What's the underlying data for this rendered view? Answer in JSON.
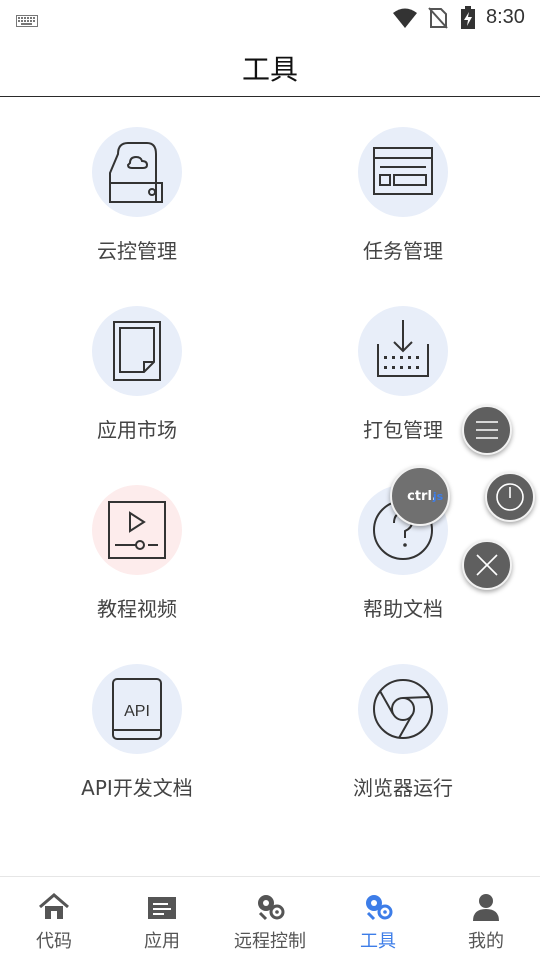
{
  "status_bar": {
    "time": "8:30",
    "icons": [
      "keyboard-icon",
      "wifi-icon",
      "no-sim-icon",
      "battery-charging-icon"
    ]
  },
  "app_bar": {
    "title": "工具"
  },
  "tools": [
    {
      "label": "云控管理",
      "icon": "cloud-storage-icon"
    },
    {
      "label": "任务管理",
      "icon": "task-window-icon"
    },
    {
      "label": "应用市场",
      "icon": "document-page-icon"
    },
    {
      "label": "打包管理",
      "icon": "download-package-icon"
    },
    {
      "label": "教程视频",
      "icon": "video-play-icon"
    },
    {
      "label": "帮助文档",
      "icon": "help-question-icon"
    },
    {
      "label": "API开发文档",
      "icon": "api-book-icon"
    },
    {
      "label": "浏览器运行",
      "icon": "browser-chrome-icon"
    }
  ],
  "floating": {
    "ctrl_logo_text": "ctrl.js",
    "buttons": [
      "menu-icon",
      "power-icon",
      "close-icon"
    ]
  },
  "tab_bar": {
    "active": "工具",
    "tabs": [
      {
        "label": "代码",
        "icon": "home-icon"
      },
      {
        "label": "应用",
        "icon": "app-card-icon"
      },
      {
        "label": "远程控制",
        "icon": "remote-control-icon"
      },
      {
        "label": "工具",
        "icon": "tools-icon"
      },
      {
        "label": "我的",
        "icon": "user-icon"
      }
    ]
  },
  "colors": {
    "accent": "#3d7de8",
    "icon_circle_bg": "#e8eef9",
    "video_circle_bg": "#fdecec",
    "fab_bg": "#5f5f5f"
  }
}
